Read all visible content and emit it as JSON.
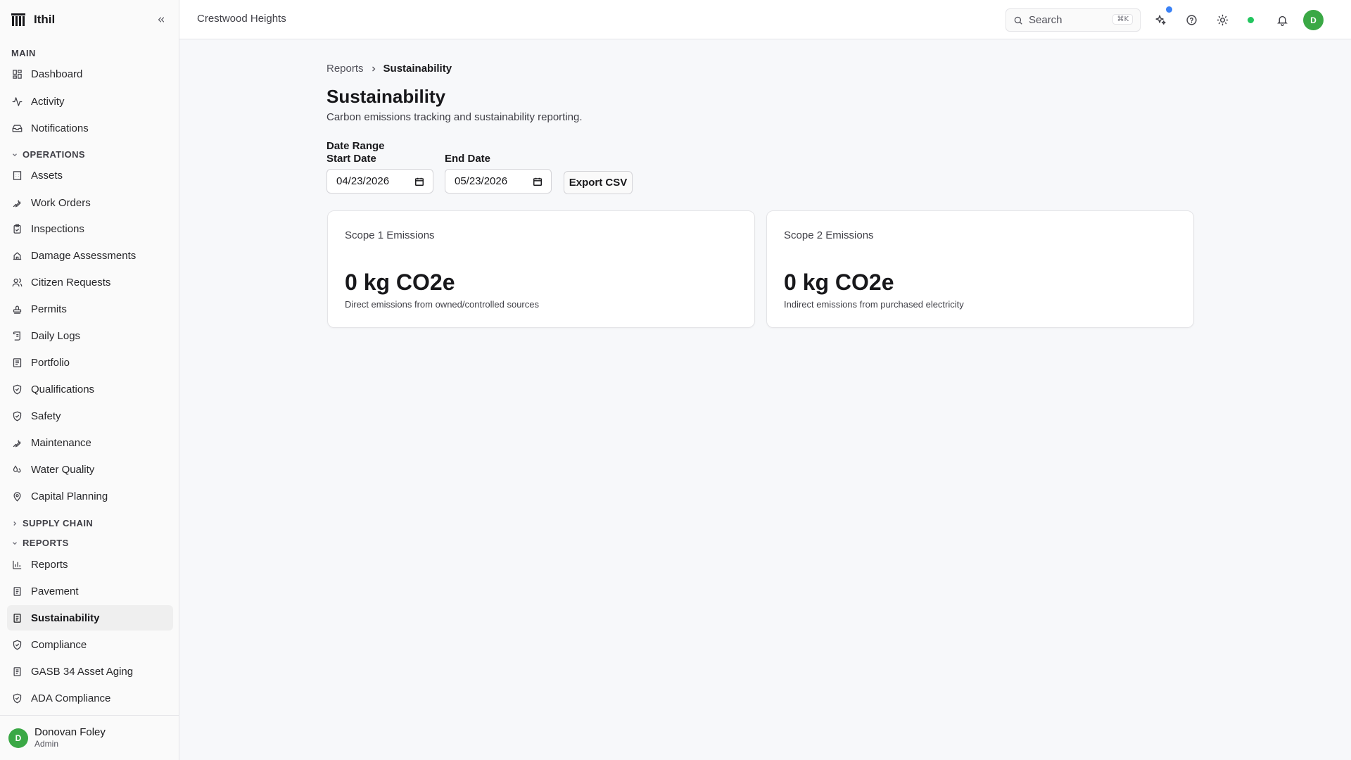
{
  "app": {
    "name": "Ithil"
  },
  "header": {
    "tenant": "Crestwood Heights",
    "search": {
      "placeholder": "Search",
      "shortcut": "⌘K"
    },
    "user_initial": "D"
  },
  "sidebar": {
    "main_label": "MAIN",
    "main_items": [
      {
        "label": "Dashboard",
        "icon": "dashboard-icon"
      },
      {
        "label": "Activity",
        "icon": "activity-icon"
      },
      {
        "label": "Notifications",
        "icon": "inbox-icon"
      }
    ],
    "operations_label": "OPERATIONS",
    "operations_items": [
      {
        "label": "Assets",
        "icon": "building-icon"
      },
      {
        "label": "Work Orders",
        "icon": "wrench-icon"
      },
      {
        "label": "Inspections",
        "icon": "clipboard-check-icon"
      },
      {
        "label": "Damage Assessments",
        "icon": "damage-icon"
      },
      {
        "label": "Citizen Requests",
        "icon": "users-icon"
      },
      {
        "label": "Permits",
        "icon": "stamp-icon"
      },
      {
        "label": "Daily Logs",
        "icon": "scroll-icon"
      },
      {
        "label": "Portfolio",
        "icon": "portfolio-icon"
      },
      {
        "label": "Qualifications",
        "icon": "shield-check-icon"
      },
      {
        "label": "Safety",
        "icon": "shield-icon"
      },
      {
        "label": "Maintenance",
        "icon": "wrench-icon"
      },
      {
        "label": "Water Quality",
        "icon": "droplets-icon"
      },
      {
        "label": "Capital Planning",
        "icon": "map-pin-icon"
      }
    ],
    "supply_chain_label": "SUPPLY CHAIN",
    "reports_label": "REPORTS",
    "reports_items": [
      {
        "label": "Reports",
        "icon": "bar-chart-icon"
      },
      {
        "label": "Pavement",
        "icon": "file-text-icon"
      },
      {
        "label": "Sustainability",
        "icon": "file-text-icon",
        "active": true
      },
      {
        "label": "Compliance",
        "icon": "shield-check-icon"
      },
      {
        "label": "GASB 34 Asset Aging",
        "icon": "file-text-icon"
      },
      {
        "label": "ADA Compliance",
        "icon": "shield-check-icon"
      }
    ],
    "user": {
      "initial": "D",
      "name": "Donovan Foley",
      "role": "Admin"
    }
  },
  "breadcrumb": {
    "parent": "Reports",
    "current": "Sustainability"
  },
  "page": {
    "title": "Sustainability",
    "subtitle": "Carbon emissions tracking and sustainability reporting."
  },
  "filters": {
    "range_label": "Date Range",
    "start_label": "Start Date",
    "start_value": "04/23/2026",
    "end_label": "End Date",
    "end_value": "05/23/2026",
    "export_label": "Export CSV"
  },
  "cards": [
    {
      "title": "Scope 1 Emissions",
      "value": "0 kg CO2e",
      "description": "Direct emissions from owned/controlled sources"
    },
    {
      "title": "Scope 2 Emissions",
      "value": "0 kg CO2e",
      "description": "Indirect emissions from purchased electricity"
    }
  ],
  "colors": {
    "avatar": "#3aa845",
    "status_online": "#22c55e",
    "notify": "#3b82f6",
    "active_nav_bg": "#efefef"
  }
}
